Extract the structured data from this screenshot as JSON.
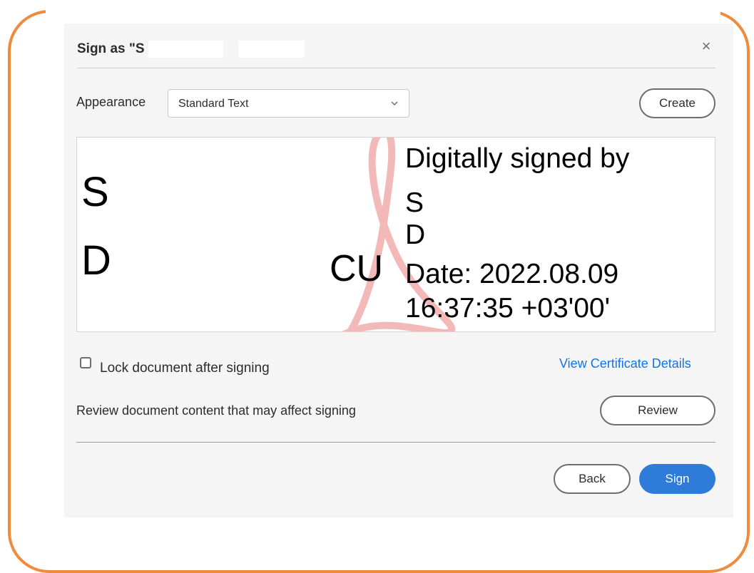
{
  "dialog": {
    "title": "Sign as \"S         D         \"",
    "close_glyph": "×"
  },
  "appearance": {
    "label": "Appearance",
    "selected": "Standard Text",
    "create_label": "Create"
  },
  "preview": {
    "initial_first": "S",
    "initial_last": "D",
    "partial_text": "CU",
    "lines": [
      "Digitally signed by",
      "S",
      "D",
      "Date: 2022.08.09",
      "16:37:35 +03'00'"
    ],
    "watermark_icon": "acrobat-logo-icon"
  },
  "options": {
    "lock_label": "Lock document after signing",
    "lock_checked": false,
    "cert_link": "View Certificate Details",
    "review_text": "Review document content that may affect signing",
    "review_label": "Review"
  },
  "footer": {
    "back_label": "Back",
    "sign_label": "Sign"
  },
  "colors": {
    "frame": "#f08a3c",
    "primary": "#2f7bd9",
    "link": "#1473e6",
    "watermark": "#f3b9b9"
  }
}
